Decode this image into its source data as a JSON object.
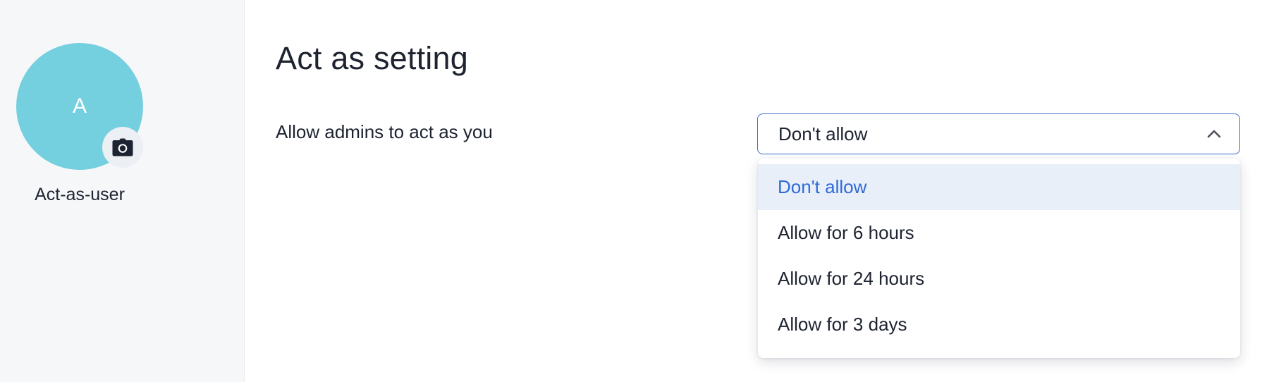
{
  "profile": {
    "avatar_initial": "A",
    "avatar_color": "#74cfde",
    "camera_icon": "camera-icon",
    "username": "Act-as-user"
  },
  "main": {
    "title": "Act as setting",
    "setting_label": "Allow admins to act as you",
    "select": {
      "value": "Don't allow",
      "expanded": true,
      "chevron_icon": "chevron-up-icon",
      "accent_color": "#3a6fd1",
      "options": [
        "Don't allow",
        "Allow for 6 hours",
        "Allow for 24 hours",
        "Allow for 3 days"
      ],
      "selected_index": 0
    }
  }
}
